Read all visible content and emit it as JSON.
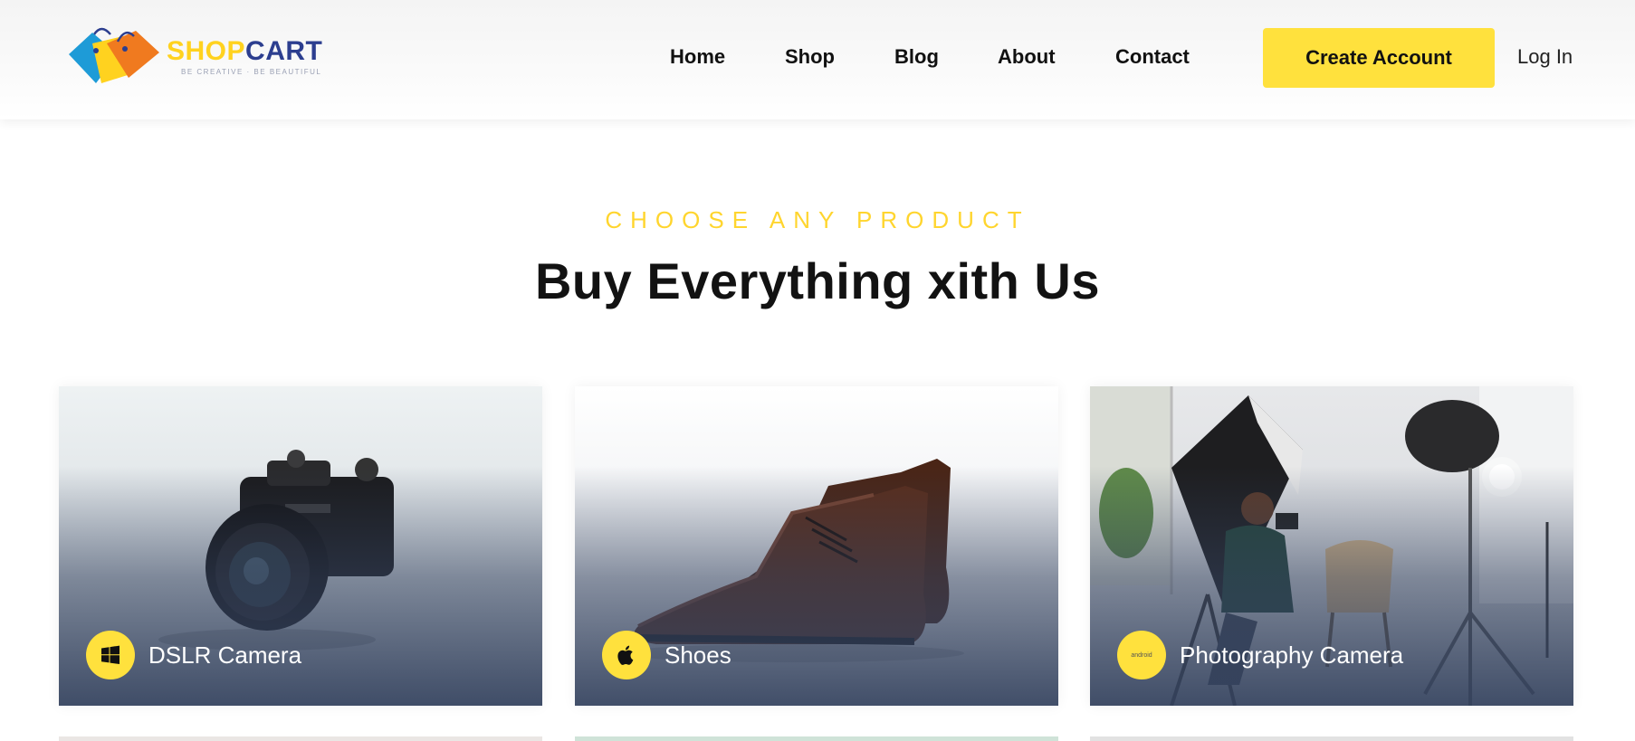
{
  "header": {
    "logo": {
      "brand_part1": "SHOP",
      "brand_part2": "CART",
      "tagline": "BE CREATIVE · BE BEAUTIFUL"
    },
    "nav": [
      {
        "label": "Home"
      },
      {
        "label": "Shop"
      },
      {
        "label": "Blog"
      },
      {
        "label": "About"
      },
      {
        "label": "Contact"
      }
    ],
    "create_account_label": "Create Account",
    "login_label": "Log In"
  },
  "section": {
    "eyebrow": "CHOOSE ANY PRODUCT",
    "title": "Buy Everything xith Us"
  },
  "cards": [
    {
      "label": "DSLR Camera",
      "icon": "windows-icon"
    },
    {
      "label": "Shoes",
      "icon": "apple-icon"
    },
    {
      "label": "Photography Camera",
      "icon": "android-icon",
      "icon_text": "android"
    }
  ],
  "colors": {
    "accent": "#ffe13d",
    "eyebrow": "#ffd52e",
    "brand_blue": "#2c3e8f",
    "card_overlay": "#34425e"
  }
}
